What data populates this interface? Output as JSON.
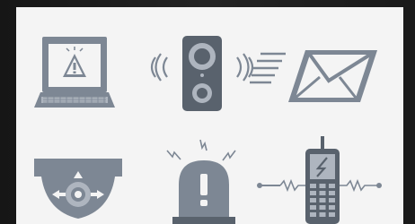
{
  "scene": {
    "background_color": "#1e1e1e",
    "panel_color": "#f4f4f4",
    "icon_color": "#7d8794",
    "icon_dark_color": "#59626d",
    "icon_light_color": "#aeb5bf",
    "icons": [
      "laptop-warning-icon",
      "alarm-speaker-icon",
      "email-envelope-icon",
      "dome-camera-icon",
      "siren-beacon-icon",
      "mobile-phone-icon"
    ]
  }
}
